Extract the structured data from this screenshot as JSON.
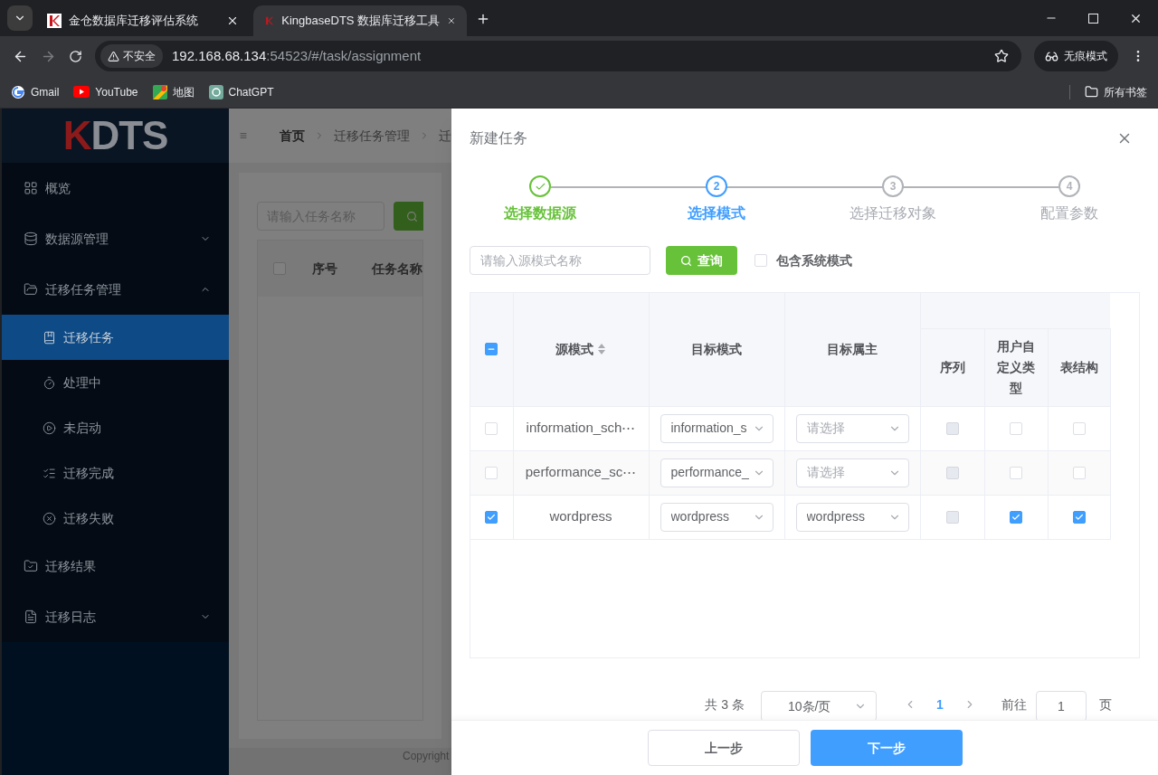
{
  "browser": {
    "tabs": [
      {
        "title": "金仓数据库迁移评估系统",
        "selected": false
      },
      {
        "title": "KingbaseDTS 数据库迁移工具",
        "selected": true
      }
    ],
    "security": "不安全",
    "url_host": "192.168.68.134",
    "url_rest": ":54523/#/task/assignment",
    "profile": "无痕模式",
    "bookmarks": [
      "Gmail",
      "YouTube",
      "地图",
      "ChatGPT"
    ],
    "bookmarks_folder": "所有书签"
  },
  "sidebar": {
    "logo_mark": "K",
    "logo_text": "DTS",
    "items": [
      {
        "label": "概览",
        "selected": false
      },
      {
        "label": "数据源管理",
        "selected": false,
        "expanded": false
      },
      {
        "label": "迁移任务管理",
        "selected": false,
        "expanded": true,
        "children": [
          {
            "label": "迁移任务",
            "selected": true
          },
          {
            "label": "处理中",
            "selected": false
          },
          {
            "label": "未启动",
            "selected": false
          },
          {
            "label": "迁移完成",
            "selected": false
          },
          {
            "label": "迁移失败",
            "selected": false
          }
        ]
      },
      {
        "label": "迁移结果",
        "selected": false
      },
      {
        "label": "迁移日志",
        "selected": false,
        "expanded": false
      }
    ]
  },
  "background": {
    "breadcrumb": [
      "首页",
      "迁移任务管理",
      "迁"
    ],
    "search": {
      "placeholder": "请输入任务名称"
    },
    "select_all": {
      "checked": false
    },
    "columns": [
      "序号",
      "任务名称"
    ],
    "footer": "Copyright"
  },
  "drawer": {
    "title": "新建任务",
    "steps": [
      {
        "label": "选择数据源",
        "done": true,
        "selected": false
      },
      {
        "label": "选择模式",
        "number": "2",
        "done": false,
        "selected": true
      },
      {
        "label": "选择迁移对象",
        "number": "3",
        "done": false,
        "selected": false
      },
      {
        "label": "配置参数",
        "number": "4",
        "done": false,
        "selected": false
      }
    ],
    "search": {
      "placeholder": "请输入源模式名称"
    },
    "query_button": "查询",
    "include_system": {
      "label": "包含系统模式",
      "checked": false
    },
    "table": {
      "select_all": {
        "indeterminate": true
      },
      "columns": [
        "源模式",
        "目标模式",
        "目标属主"
      ],
      "object_columns": [
        "序列",
        "用户自定义类型",
        "表结构"
      ],
      "rows": [
        {
          "selected": false,
          "source": "information_sch⋯",
          "target": "information_s",
          "owner": {
            "placeholder": "请选择"
          },
          "objects": [
            {
              "checked": false,
              "disabled": true
            },
            {
              "checked": false,
              "disabled": false
            },
            {
              "checked": false,
              "disabled": false
            }
          ]
        },
        {
          "selected": false,
          "source": "performance_sc⋯",
          "target": "performance_",
          "owner": {
            "placeholder": "请选择"
          },
          "objects": [
            {
              "checked": false,
              "disabled": true
            },
            {
              "checked": false,
              "disabled": false
            },
            {
              "checked": false,
              "disabled": false
            }
          ]
        },
        {
          "selected": true,
          "source": "wordpress",
          "target": "wordpress",
          "owner": {
            "value": "wordpress"
          },
          "objects": [
            {
              "checked": false,
              "disabled": true
            },
            {
              "checked": true,
              "disabled": false
            },
            {
              "checked": true,
              "disabled": false
            }
          ]
        }
      ]
    },
    "pagination": {
      "total": "共 3 条",
      "page_size": "10条/页",
      "pages": [
        {
          "label": "1",
          "selected": true
        }
      ],
      "goto_label": "前往",
      "goto_value": "1",
      "goto_suffix": "页"
    },
    "buttons": {
      "prev": "上一步",
      "next": "下一步"
    }
  }
}
